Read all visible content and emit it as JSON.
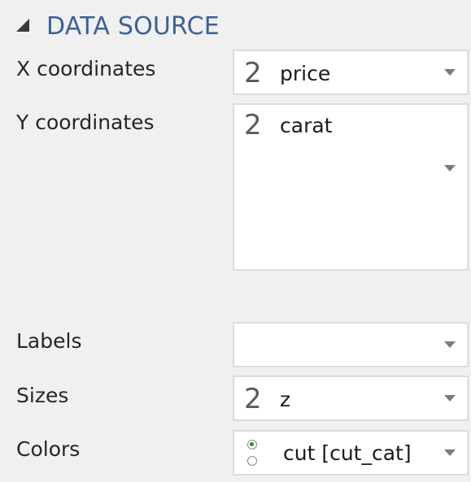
{
  "section": {
    "title": "DATA SOURCE",
    "collapse_icon": "triangle-collapse-icon"
  },
  "rows": {
    "x": {
      "label": "X coordinates",
      "value": "price",
      "type_icon": "2"
    },
    "y": {
      "label": "Y coordinates",
      "value": "carat",
      "type_icon": "2"
    },
    "labels": {
      "label": "Labels",
      "value": ""
    },
    "sizes": {
      "label": "Sizes",
      "value": "z",
      "type_icon": "2"
    },
    "colors": {
      "label": "Colors",
      "value": "cut [cut_cat]",
      "type_icon": "radio-category-icon"
    }
  },
  "colors": {
    "accent": "#3d6196",
    "background": "#f0f0f0",
    "field_border": "#dcdcdc",
    "radio_checked": "#2e8b2e"
  }
}
